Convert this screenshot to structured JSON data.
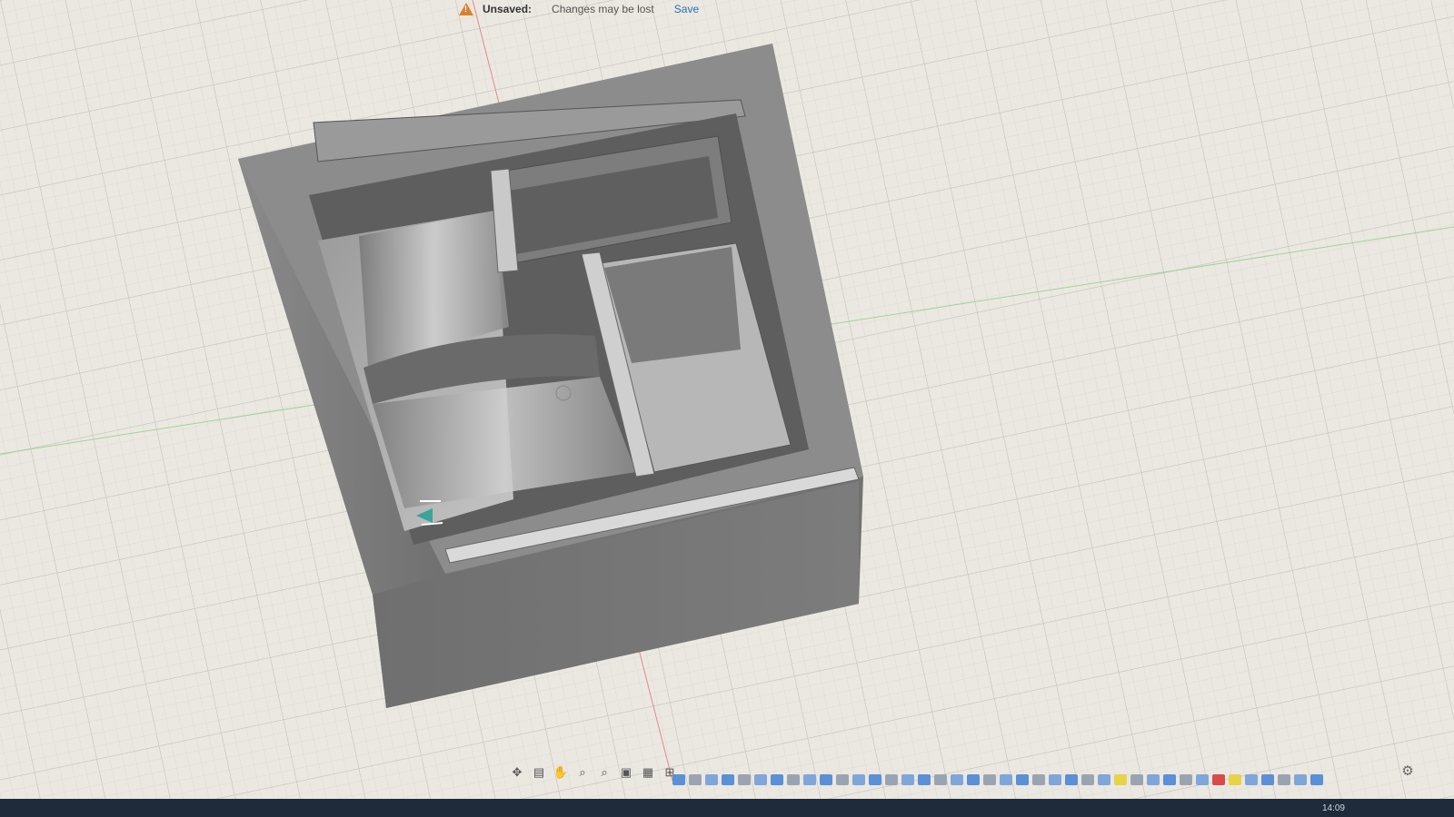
{
  "banner": {
    "status_label": "Unsaved:",
    "message": "Changes may be lost",
    "save_label": "Save"
  },
  "navbar": {
    "items": [
      {
        "icon": "orbit-icon",
        "glyph": "✥"
      },
      {
        "icon": "look-at-icon",
        "glyph": "▤"
      },
      {
        "icon": "pan-icon",
        "glyph": "✋"
      },
      {
        "icon": "zoom-icon",
        "glyph": "⌕"
      },
      {
        "icon": "fit-icon",
        "glyph": "⌕"
      },
      {
        "icon": "display-settings-icon",
        "glyph": "▣"
      },
      {
        "icon": "grid-icon",
        "glyph": "▦"
      },
      {
        "icon": "viewports-icon",
        "glyph": "⊞"
      }
    ]
  },
  "timeline": {
    "highlighted_colors": [
      "#e5d34a",
      "#d94b4b",
      "#e5d34a"
    ]
  },
  "clock": {
    "time": "14:09"
  },
  "colors": {
    "background": "#e9e6df",
    "grid_minor": "#d2d4cc",
    "grid_major": "#b9bcb3",
    "body_dark": "#6a6a6a",
    "body_mid": "#8a8a8a",
    "body_light": "#a9a9a9",
    "accent": "#2b6fb8"
  }
}
